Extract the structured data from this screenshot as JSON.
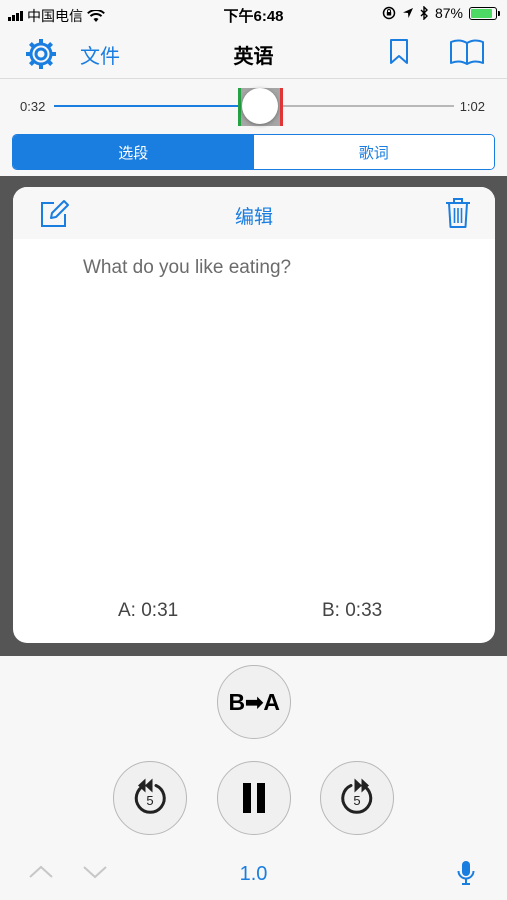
{
  "status": {
    "carrier": "中国电信",
    "time": "下午6:48",
    "battery": "87%",
    "battery_level": 0.87
  },
  "nav": {
    "files_label": "文件",
    "title": "英语"
  },
  "slider": {
    "current_time": "0:32",
    "total_time": "1:02",
    "progress": 0.516,
    "a_position": 0.5,
    "b_position": 0.532
  },
  "segments": [
    {
      "label": "选段",
      "active": true
    },
    {
      "label": "歌词",
      "active": false
    }
  ],
  "editor": {
    "title": "编辑",
    "sentence": "What do you like eating?",
    "a_time": "A: 0:31",
    "b_time": "B: 0:33"
  },
  "controls": {
    "ab_label": "B➡A",
    "rewind_seconds": "5",
    "forward_seconds": "5",
    "speed": "1.0"
  },
  "colors": {
    "accent": "#1a7de0",
    "a_marker": "#25a244",
    "b_marker": "#e23636",
    "battery": "#4cd964"
  },
  "icons": [
    "gear-icon",
    "bookmark-icon",
    "book-icon",
    "edit-icon",
    "trash-icon",
    "rewind-icon",
    "pause-icon",
    "forward-icon",
    "chevron-up-icon",
    "chevron-down-icon",
    "mic-icon",
    "wifi-icon",
    "location-icon",
    "bluetooth-icon",
    "rotation-lock-icon"
  ]
}
